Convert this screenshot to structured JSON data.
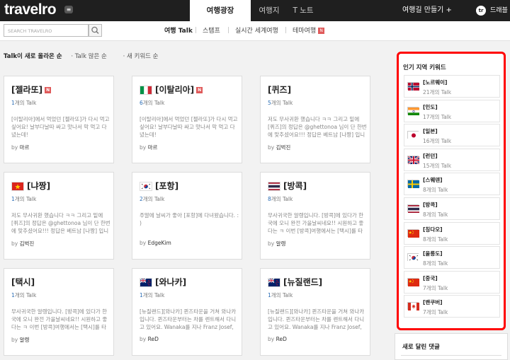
{
  "header": {
    "logo": "travelro",
    "tabs": [
      "여행광장",
      "여행지",
      "T 노트"
    ],
    "make_trip": "여행길 만들기 +",
    "user_initials": "tr",
    "user_name": "드래블로 ▾"
  },
  "search": {
    "placeholder": "SEARCH TRAVELRO"
  },
  "subnav": [
    "여행 Talk",
    "스탬프",
    "실시간 세계여행",
    "테마여행"
  ],
  "sort": [
    "Talk이 새로 올라온 순",
    "Talk 많은 순",
    "새 키워드 순"
  ],
  "cards": [
    {
      "title": "[젤라또]",
      "count": "1",
      "unit": "개의 Talk",
      "body": "[이탈리아]에서 먹었던 [젤라또]가 다시 먹고싶어요! 날부다날따 싸고 맛나서 막 먹고 다녔는데!",
      "by_label": "by",
      "author": "마르",
      "flag": "none",
      "badge": "N"
    },
    {
      "title": "[이탈리아]",
      "count": "6",
      "unit": "개의 Talk",
      "body": "[이탈리아]에서 먹었던 [젤라또]가 다시 먹고싶어요! 날부다날따 싸고 맛나서 막 먹고 다녔는데!",
      "by_label": "by",
      "author": "마르",
      "flag": "it",
      "badge": "N"
    },
    {
      "title": "[퀴즈]",
      "count": "5",
      "unit": "개의 Talk",
      "body": "저도 무사귀환 했습니다 ㅋㅋ 그리고 밑에 [퀴즈]의 정답은 @ghettonoa 님이 단 한번에 맞추셨어요!!! 정답은 베트남 [나짱] 입니다. ...",
      "by_label": "by",
      "author": "김벅진",
      "flag": "none",
      "badge": ""
    },
    {
      "title": "[냐짱]",
      "count": "1",
      "unit": "개의 Talk",
      "body": "저도 무사귀환 했습니다 ㅋㅋ 그리고 밑에 [퀴즈]의 정답은 @ghettonoa 님이 단 한번에 맞추셨어요!!! 정답은 베트남 [나짱] 입니다. ...",
      "by_label": "by",
      "author": "김벅진",
      "flag": "vn",
      "badge": ""
    },
    {
      "title": "[포항]",
      "count": "2",
      "unit": "개의 Talk",
      "body": "주말에 날씨가 좋아 [포항]에 다녀왔습니다. : )",
      "by_label": "by",
      "author": "EdgeKim",
      "flag": "kr",
      "badge": ""
    },
    {
      "title": "[방콕]",
      "count": "8",
      "unit": "개의 Talk",
      "body": "무사귀국한 알렝입니다. [방콕]에 있다가 한국에 오니 완전 가을날씨네요!! 시원하고 좋다는 ㅋ 이번 [방콕]여행에서는 [택시]를 타지 않고 지내...",
      "by_label": "by",
      "author": "알렝",
      "flag": "th",
      "badge": ""
    },
    {
      "title": "[택시]",
      "count": "1",
      "unit": "개의 Talk",
      "body": "무사귀국한 알렝입니다. [방콕]에 있다가 한국에 오니 완전 가을날씨네요!! 시원하고 좋다는 ㅋ 이번 [방콕]여행에서는 [택시]를 타지 않고 지내...",
      "by_label": "by",
      "author": "알렝",
      "flag": "none",
      "badge": ""
    },
    {
      "title": "[와나카]",
      "count": "1",
      "unit": "개의 Talk",
      "body": "[뉴질랜드][와나카] 퀸즈타운을 거쳐 와나카입니다. 퀸즈타운부터는 차를 렌트해서 다니고 있어요. Wanaka를 지나 Franz Josef, Gr...",
      "by_label": "by",
      "author": "ReD",
      "flag": "nz",
      "badge": ""
    },
    {
      "title": "[뉴질랜드]",
      "count": "1",
      "unit": "개의 Talk",
      "body": "[뉴질랜드][와나카] 퀸즈타운을 거쳐 와나카입니다. 퀸즈타운부터는 차를 렌트해서 다니고 있어요. Wanaka를 지나 Franz Josef, Gr...",
      "by_label": "by",
      "author": "ReD",
      "flag": "nz",
      "badge": ""
    }
  ],
  "sidebar": {
    "title": "인기 지역 키워드",
    "keywords": [
      {
        "name": "[노르웨이]",
        "count": "21개의 Talk",
        "flag": "no"
      },
      {
        "name": "[인도]",
        "count": "17개의 Talk",
        "flag": "in"
      },
      {
        "name": "[일본]",
        "count": "16개의 Talk",
        "flag": "jp"
      },
      {
        "name": "[런던]",
        "count": "15개의 Talk",
        "flag": "gb"
      },
      {
        "name": "[스웨덴]",
        "count": "8개의 Talk",
        "flag": "se"
      },
      {
        "name": "[방콕]",
        "count": "8개의 Talk",
        "flag": "th"
      },
      {
        "name": "[칭다오]",
        "count": "8개의 Talk",
        "flag": "cn"
      },
      {
        "name": "[울릉도]",
        "count": "8개의 Talk",
        "flag": "kr"
      },
      {
        "name": "[중국]",
        "count": "7개의 Talk",
        "flag": "cn"
      },
      {
        "name": "[밴쿠버]",
        "count": "7개의 Talk",
        "flag": "ca"
      }
    ],
    "comments_title": "새로 달린 댓글"
  },
  "colors": {
    "highlight_border": "#ff0000",
    "link_blue": "#2a6db5",
    "topbar": "#1f1f1f"
  }
}
